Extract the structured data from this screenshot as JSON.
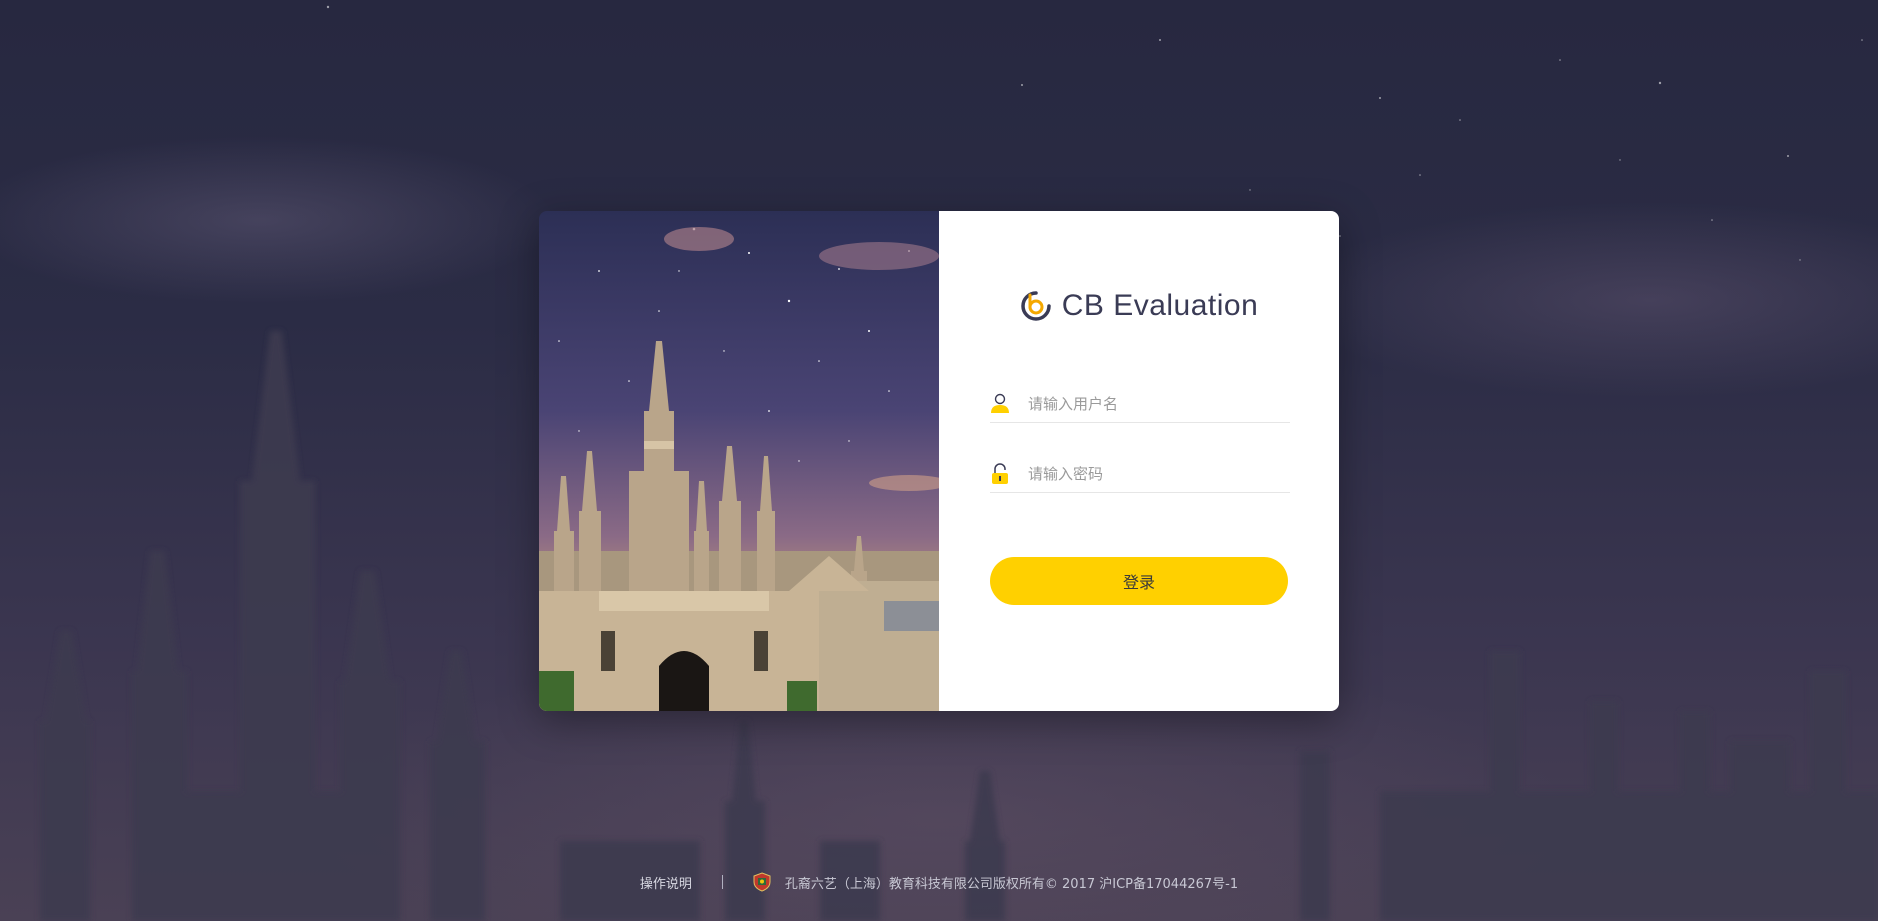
{
  "brand": {
    "name": "CB Evaluation",
    "accent_color": "#ffd000",
    "logo_icon": "cb-logo-icon"
  },
  "login_form": {
    "username": {
      "placeholder": "请输入用户名",
      "value": "",
      "icon": "user-icon"
    },
    "password": {
      "placeholder": "请输入密码",
      "value": "",
      "icon": "lock-icon"
    },
    "submit_label": "登录"
  },
  "footer": {
    "help_link": "操作说明",
    "company_icon": "company-shield-icon",
    "copyright": "孔裔六艺（上海）教育科技有限公司版权所有© 2017 沪ICP备17044267号-1"
  }
}
